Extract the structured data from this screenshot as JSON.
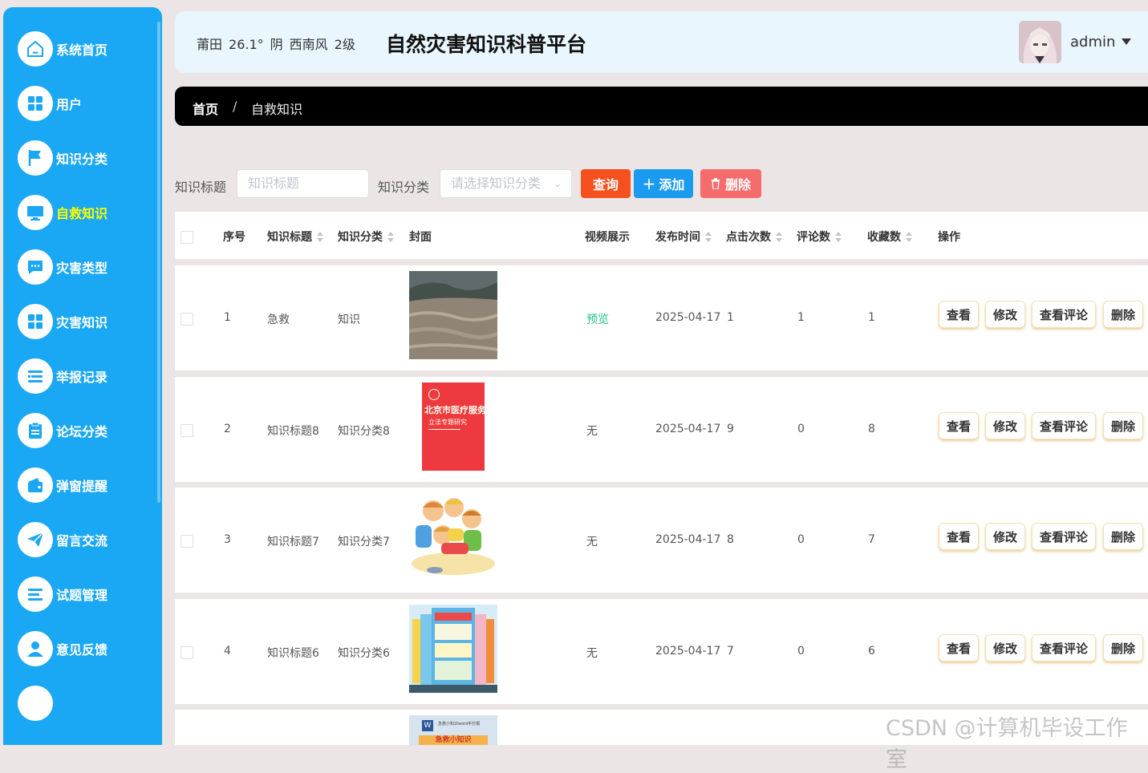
{
  "sidebar": {
    "items": [
      {
        "label": "系统首页",
        "icon": "home-icon",
        "active": false
      },
      {
        "label": "用户",
        "icon": "grid-icon",
        "active": false
      },
      {
        "label": "知识分类",
        "icon": "flag-icon",
        "active": false
      },
      {
        "label": "自救知识",
        "icon": "monitor-icon",
        "active": true
      },
      {
        "label": "灾害类型",
        "icon": "chat-icon",
        "active": false
      },
      {
        "label": "灾害知识",
        "icon": "grid-icon",
        "active": false
      },
      {
        "label": "举报记录",
        "icon": "list-icon",
        "active": false
      },
      {
        "label": "论坛分类",
        "icon": "clipboard-icon",
        "active": false
      },
      {
        "label": "弹窗提醒",
        "icon": "wallet-icon",
        "active": false
      },
      {
        "label": "留言交流",
        "icon": "send-icon",
        "active": false
      },
      {
        "label": "试题管理",
        "icon": "lines-icon",
        "active": false
      },
      {
        "label": "意见反馈",
        "icon": "user-icon",
        "active": false
      }
    ]
  },
  "header": {
    "city": "莆田",
    "temp": "26.1°",
    "weather": "阴",
    "wind": "西南风",
    "level": "2级",
    "title": "自然灾害知识科普平台",
    "user": "admin"
  },
  "breadcrumb": {
    "home": "首页",
    "sep": "/",
    "current": "自救知识"
  },
  "filter": {
    "title_label": "知识标题",
    "title_placeholder": "知识标题",
    "category_label": "知识分类",
    "category_placeholder": "请选择知识分类",
    "query_btn": "查询",
    "add_btn": "添加",
    "delete_btn": "删除"
  },
  "table": {
    "headers": {
      "index": "序号",
      "title": "知识标题",
      "category": "知识分类",
      "cover": "封面",
      "video": "视频展示",
      "time": "发布时间",
      "clicks": "点击次数",
      "comments": "评论数",
      "favorites": "收藏数",
      "ops": "操作"
    },
    "rows": [
      {
        "index": "1",
        "title": "急救",
        "category": "知识",
        "video": "预览",
        "time": "2025-04-17",
        "clicks": "1",
        "comments": "1",
        "favorites": "1"
      },
      {
        "index": "2",
        "title": "知识标题8",
        "category": "知识分类8",
        "video": "无",
        "time": "2025-04-17",
        "clicks": "9",
        "comments": "0",
        "favorites": "8"
      },
      {
        "index": "3",
        "title": "知识标题7",
        "category": "知识分类7",
        "video": "无",
        "time": "2025-04-17",
        "clicks": "8",
        "comments": "0",
        "favorites": "7"
      },
      {
        "index": "4",
        "title": "知识标题6",
        "category": "知识分类6",
        "video": "无",
        "time": "2025-04-17",
        "clicks": "7",
        "comments": "0",
        "favorites": "6"
      }
    ],
    "ops": {
      "view": "查看",
      "edit": "修改",
      "comments": "查看评论",
      "delete": "删除"
    }
  },
  "covers": {
    "book_title": "北京市医疗服务",
    "book_subtitle": "立法专题研究",
    "doc_header": "急救小知识word手抄报",
    "doc_banner": "急救小知识"
  },
  "watermark": "CSDN @计算机毕设工作室",
  "colors": {
    "sidebar": "#1aa7f3",
    "query": "#f4511e",
    "add": "#1a9bf0",
    "delete": "#f56c6c",
    "preview": "#24c28b"
  }
}
